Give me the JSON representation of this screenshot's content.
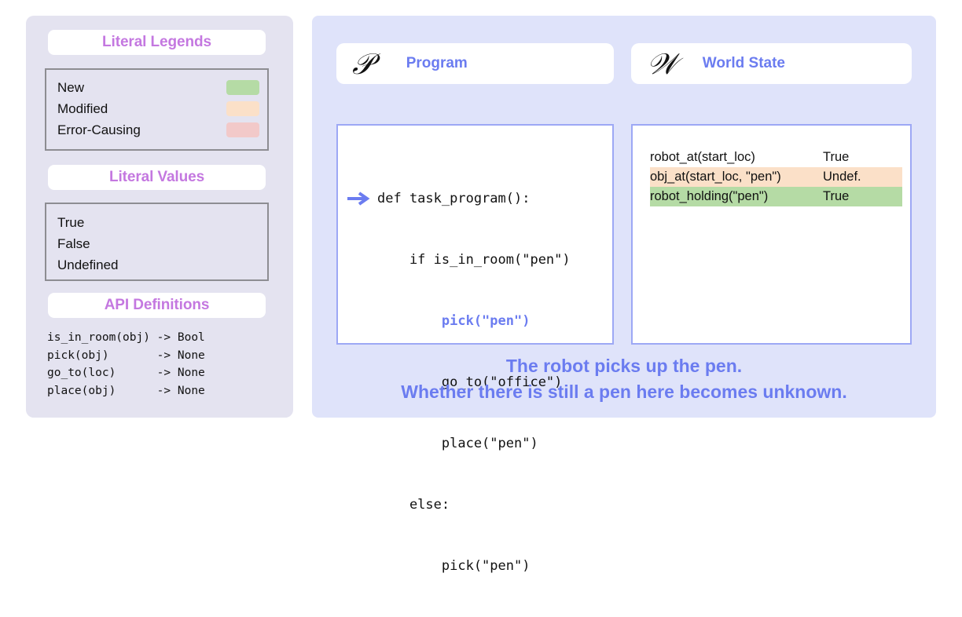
{
  "left_panel": {
    "legend_section": {
      "title": "Literal Legends",
      "items": [
        {
          "label": "New",
          "color": "#b5dba5"
        },
        {
          "label": "Modified",
          "color": "#fbe0c8"
        },
        {
          "label": "Error-Causing",
          "color": "#f2c9c9"
        }
      ]
    },
    "values_section": {
      "title": "Literal Values",
      "items": [
        {
          "label": "True"
        },
        {
          "label": "False"
        },
        {
          "label": "Undefined"
        }
      ]
    },
    "api_section": {
      "title": "API Definitions",
      "definitions": "is_in_room(obj) -> Bool\npick(obj)       -> None\ngo_to(loc)      -> None\nplace(obj)      -> None"
    }
  },
  "right_panel": {
    "program_panel": {
      "glyph": "𝒫",
      "glyph_name": "script-capital-p",
      "title": "Program",
      "code_lines": [
        {
          "text": "def task_program():",
          "current": false
        },
        {
          "text": "    if is_in_room(\"pen\")",
          "current": false
        },
        {
          "text": "        pick(\"pen\")",
          "current": true
        },
        {
          "text": "        go_to(\"office\")",
          "current": false
        },
        {
          "text": "        place(\"pen\")",
          "current": false
        },
        {
          "text": "    else:",
          "current": false
        },
        {
          "text": "        pick(\"pen\")",
          "current": false
        }
      ]
    },
    "world_state_panel": {
      "glyph": "𝒲",
      "glyph_name": "script-capital-w",
      "title": "World State",
      "rows": [
        {
          "predicate": "robot_at(start_loc)",
          "value": "True",
          "highlight": "none"
        },
        {
          "predicate": "obj_at(start_loc, \"pen\")",
          "value": "Undef.",
          "highlight": "modified"
        },
        {
          "predicate": "robot_holding(\"pen\")",
          "value": "True",
          "highlight": "new"
        }
      ]
    },
    "caption_line_1": "The robot picks up the pen.",
    "caption_line_2": "Whether there is still a pen here becomes unknown."
  },
  "colors": {
    "accent_blue": "#6b7cf0",
    "accent_purple": "#c478e0",
    "left_panel_bg": "#e4e3f0",
    "right_panel_bg": "#dfe3fa",
    "new_highlight": "#b5dba5",
    "modified_highlight": "#fbe0c8",
    "error_highlight": "#f2c9c9"
  }
}
